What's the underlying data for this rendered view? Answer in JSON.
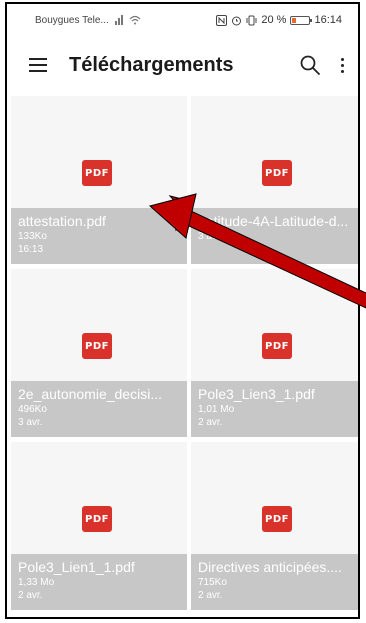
{
  "status_bar": {
    "carrier": "Bouygues Tele...",
    "status_text": "20 %",
    "time": "16:14"
  },
  "app_bar": {
    "title": "Téléchargements",
    "icons": [
      "menu-icon",
      "search-icon",
      "more-vert-icon"
    ]
  },
  "files": [
    {
      "name": "attestation.pdf",
      "size": "133Ko",
      "date": "16:13"
    },
    {
      "name": "Latitude-4A-Latitude-d...",
      "size": "",
      "date": "3 avr."
    },
    {
      "name": "2e_autonomie_decisi...",
      "size": "496Ko",
      "date": "3 avr."
    },
    {
      "name": "Pole3_Lien3_1.pdf",
      "size": "1,01 Mo",
      "date": "2 avr."
    },
    {
      "name": "Pole3_Lien1_1.pdf",
      "size": "1,33 Mo",
      "date": "2 avr."
    },
    {
      "name": "Directives anticipées....",
      "size": "715Ko",
      "date": "2 avr."
    }
  ],
  "pdf_badge_label": "PDF",
  "colors": {
    "pdf_badge": "#d8322b",
    "caption_bg": "#c7c7c7",
    "annotation_arrow": "#c00000"
  }
}
